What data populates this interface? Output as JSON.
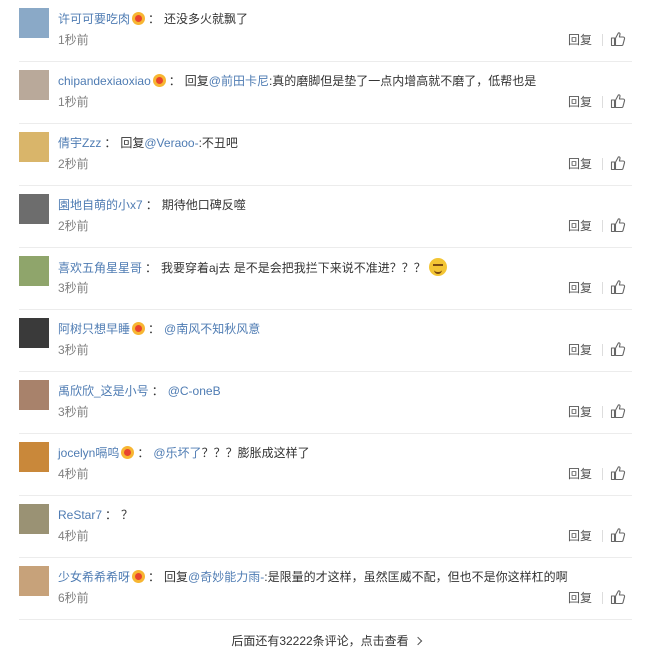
{
  "comments": [
    {
      "user": "许可可要吃肉",
      "vip": true,
      "reply_prefix": "",
      "mention": "",
      "text": "还没多火就飘了",
      "time": "1秒前",
      "avatar_color": "#8aa9c7"
    },
    {
      "user": "chipandexiaoxiao",
      "vip": true,
      "reply_prefix": "回复",
      "mention": "@前田卡尼",
      "text": ":真的磨脚但是垫了一点内增高就不磨了，低帮也是",
      "time": "1秒前",
      "avatar_color": "#b9a99a"
    },
    {
      "user": "倩宇Zzz",
      "vip": false,
      "reply_prefix": "回复",
      "mention": "@Veraoo-",
      "text": ":不丑吧",
      "time": "2秒前",
      "avatar_color": "#d9b56a"
    },
    {
      "user": "園地自萌的小x7",
      "vip": false,
      "reply_prefix": "",
      "mention": "",
      "text": "期待他口碑反噬",
      "time": "2秒前",
      "avatar_color": "#6d6d6d"
    },
    {
      "user": "喜欢五角星星哥",
      "vip": false,
      "reply_prefix": "",
      "mention": "",
      "text": "我要穿着aj去 是不是会把我拦下来说不准进？？？",
      "time": "3秒前",
      "avatar_color": "#8fa56b",
      "emoji": true
    },
    {
      "user": "阿树只想早睡",
      "vip": true,
      "reply_prefix": "",
      "mention": "@南风不知秋风意",
      "text": "",
      "time": "3秒前",
      "avatar_color": "#3a3a3a"
    },
    {
      "user": "禹欣欣_这是小号",
      "vip": false,
      "reply_prefix": "",
      "mention": "@C-oneB",
      "text": "",
      "time": "3秒前",
      "avatar_color": "#a8826b"
    },
    {
      "user": "jocelyn嗝呜",
      "vip": true,
      "reply_prefix": "",
      "mention": "@乐坏了",
      "text": "？？？膨胀成这样了",
      "time": "4秒前",
      "avatar_color": "#c9883a"
    },
    {
      "user": "ReStar7",
      "vip": false,
      "reply_prefix": "",
      "mention": "",
      "text": "？",
      "time": "4秒前",
      "avatar_color": "#9a9274"
    },
    {
      "user": "少女希希希呀",
      "vip": true,
      "reply_prefix": "回复",
      "mention": "@奇妙能力雨-",
      "text": ":是限量的才这样，虽然匡威不配，但也不是你这样杠的啊",
      "time": "6秒前",
      "avatar_color": "#c7a27a"
    }
  ],
  "reply_label": "回复",
  "more_label": "后面还有32222条评论，点击查看",
  "colors": {
    "link": "#4f7cb3",
    "time": "#808080"
  }
}
